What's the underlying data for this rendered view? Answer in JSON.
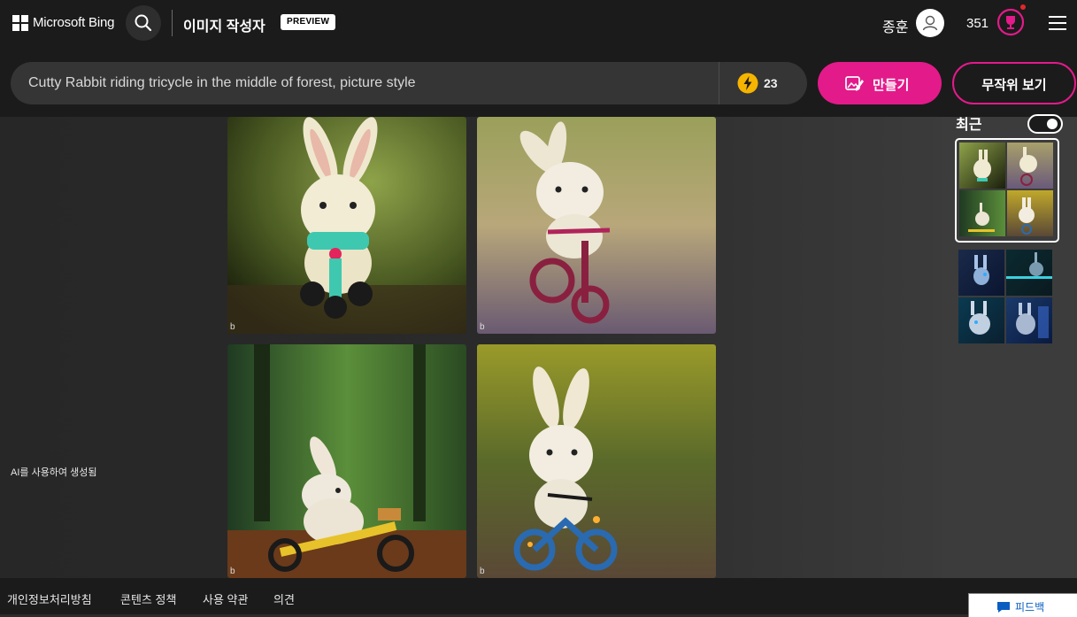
{
  "header": {
    "brand": "Microsoft Bing",
    "app_title": "이미지 작성자",
    "preview_badge": "PREVIEW",
    "user_name": "종훈",
    "reward_points": "351",
    "icons": [
      "microsoft-logo-icon",
      "search-icon",
      "user-avatar-icon",
      "rewards-trophy-icon",
      "hamburger-menu-icon"
    ]
  },
  "prompt": {
    "value": "Cutty Rabbit riding tricycle in the middle of forest, picture style",
    "boost_count": "23",
    "create_label": "만들기",
    "surprise_label": "무작위 보기"
  },
  "results": {
    "ai_generated_label": "AI를 사용하여 생성됨",
    "images": [
      {
        "subject": "white rabbit on teal tricycle",
        "palette": [
          "#6e8b3a",
          "#1f2a10"
        ]
      },
      {
        "subject": "white rabbit on purple tricycle",
        "palette": [
          "#a8a06a",
          "#6a5a7a"
        ]
      },
      {
        "subject": "rabbit on yellow tricycle in forest",
        "palette": [
          "#3f6b3a",
          "#7a3a1a"
        ]
      },
      {
        "subject": "rabbit on blue tricycle",
        "palette": [
          "#8a8a2a",
          "#5a4a3a"
        ]
      }
    ],
    "watermark": "b"
  },
  "sidebar": {
    "recent_label": "최근",
    "recent_toggle_on": true
  },
  "footer": {
    "links": [
      "개인정보처리방침",
      "콘텐츠 정책",
      "사용 약관",
      "의견"
    ],
    "feedback_label": "피드백"
  },
  "colors": {
    "accent": "#e31a8a",
    "background": "#1b1b1b",
    "boost": "#f5b400",
    "link_blue": "#0a5ec2"
  }
}
